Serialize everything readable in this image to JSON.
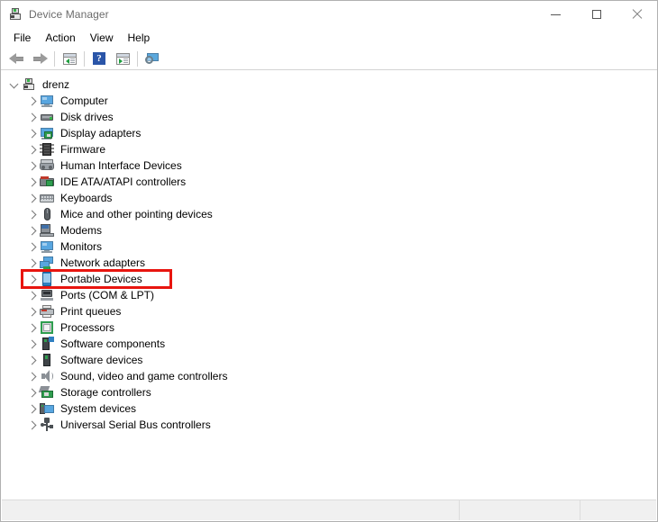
{
  "window": {
    "title": "Device Manager",
    "icon": "device-manager-icon",
    "controls": {
      "minimize": "minimize-icon",
      "maximize": "maximize-icon",
      "close": "close-icon"
    }
  },
  "menubar": {
    "items": [
      {
        "label": "File"
      },
      {
        "label": "Action"
      },
      {
        "label": "View"
      },
      {
        "label": "Help"
      }
    ]
  },
  "toolbar": {
    "buttons": [
      {
        "name": "back-button",
        "icon": "back-arrow-icon"
      },
      {
        "name": "forward-button",
        "icon": "forward-arrow-icon"
      },
      {
        "name": "properties-button",
        "icon": "properties-icon"
      },
      {
        "name": "help-button",
        "icon": "help-question-icon"
      },
      {
        "name": "scan-hardware-changes-button",
        "icon": "scan-icon"
      },
      {
        "name": "show-hidden-devices-button",
        "icon": "monitor-search-icon"
      }
    ]
  },
  "tree": {
    "root": {
      "label": "drenz",
      "icon": "device-manager-icon",
      "expanded": true
    },
    "nodes": [
      {
        "label": "Computer",
        "icon": "monitor-icon"
      },
      {
        "label": "Disk drives",
        "icon": "disk-drive-icon"
      },
      {
        "label": "Display adapters",
        "icon": "display-adapter-icon"
      },
      {
        "label": "Firmware",
        "icon": "chip-icon"
      },
      {
        "label": "Human Interface Devices",
        "icon": "hid-icon"
      },
      {
        "label": "IDE ATA/ATAPI controllers",
        "icon": "ide-controller-icon"
      },
      {
        "label": "Keyboards",
        "icon": "keyboard-icon"
      },
      {
        "label": "Mice and other pointing devices",
        "icon": "mouse-icon"
      },
      {
        "label": "Modems",
        "icon": "modem-icon"
      },
      {
        "label": "Monitors",
        "icon": "monitor-icon"
      },
      {
        "label": "Network adapters",
        "icon": "network-adapter-icon"
      },
      {
        "label": "Portable Devices",
        "icon": "portable-device-icon",
        "highlighted": true
      },
      {
        "label": "Ports (COM & LPT)",
        "icon": "port-icon"
      },
      {
        "label": "Print queues",
        "icon": "printer-icon"
      },
      {
        "label": "Processors",
        "icon": "processor-icon"
      },
      {
        "label": "Software components",
        "icon": "software-component-icon"
      },
      {
        "label": "Software devices",
        "icon": "software-device-icon"
      },
      {
        "label": "Sound, video and game controllers",
        "icon": "speaker-icon"
      },
      {
        "label": "Storage controllers",
        "icon": "storage-controller-icon"
      },
      {
        "label": "System devices",
        "icon": "system-device-icon"
      },
      {
        "label": "Universal Serial Bus controllers",
        "icon": "usb-icon"
      }
    ]
  },
  "annotation": {
    "target_label": "Portable Devices",
    "color": "#e8150f"
  },
  "statusbar": {
    "panes": [
      "",
      "",
      ""
    ]
  },
  "colors": {
    "window_background": "#ffffff",
    "title_text": "#6b6b6b",
    "status_background": "#f0f0f0",
    "highlight": "#e8150f"
  }
}
